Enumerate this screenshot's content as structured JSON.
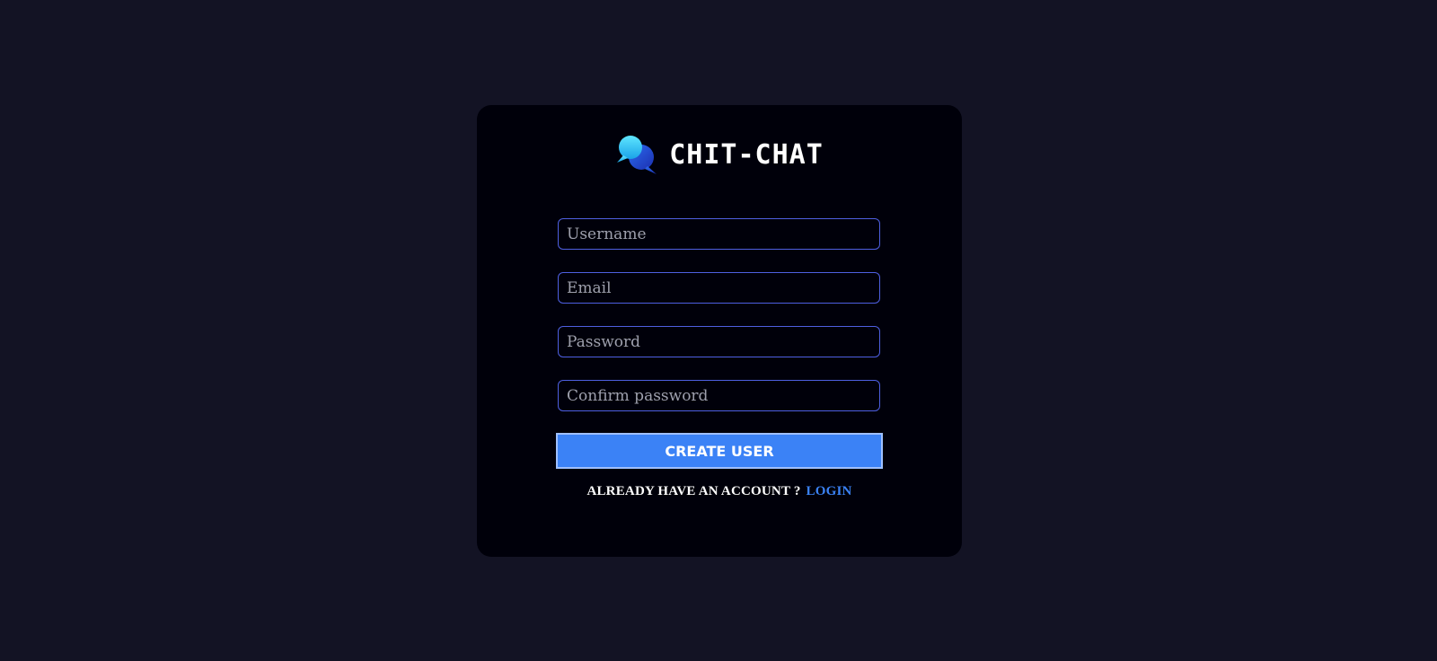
{
  "brand": {
    "title": "CHIT-CHAT",
    "logo_icon": "chat-bubbles-icon"
  },
  "form": {
    "fields": [
      {
        "name": "username",
        "placeholder": "Username",
        "value": ""
      },
      {
        "name": "email",
        "placeholder": "Email",
        "value": ""
      },
      {
        "name": "password",
        "placeholder": "Password",
        "value": ""
      },
      {
        "name": "confirm_password",
        "placeholder": "Confirm password",
        "value": ""
      }
    ],
    "submit_label": "CREATE USER"
  },
  "footer": {
    "prompt": "ALREADY HAVE AN ACCOUNT ?",
    "link_label": "LOGIN"
  },
  "colors": {
    "background": "#131324",
    "card": "#00000a",
    "accent": "#3b82f6",
    "input_border": "#4e5fe0"
  }
}
